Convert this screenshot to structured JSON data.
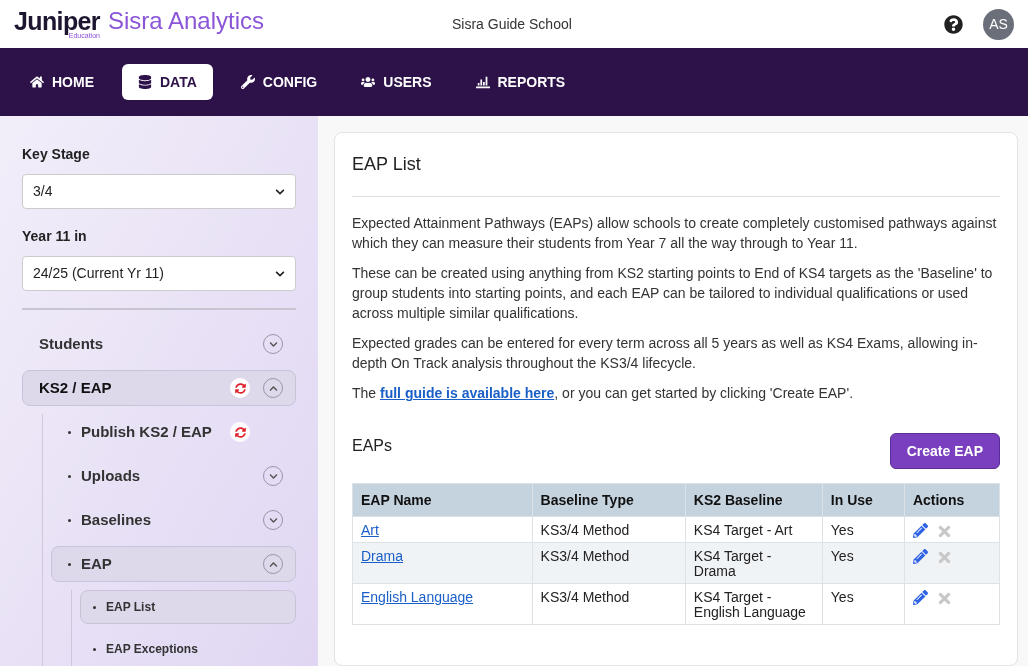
{
  "brand": {
    "name": "Juniper",
    "sub": "Education",
    "product": "Sisra Analytics"
  },
  "school": "Sisra Guide School",
  "user": {
    "initials": "AS"
  },
  "nav": [
    {
      "label": "HOME",
      "kind": "home",
      "selected": false
    },
    {
      "label": "DATA",
      "kind": "database",
      "selected": true
    },
    {
      "label": "CONFIG",
      "kind": "wrench",
      "selected": false
    },
    {
      "label": "USERS",
      "kind": "users",
      "selected": false
    },
    {
      "label": "REPORTS",
      "kind": "chart",
      "selected": false
    }
  ],
  "sidebar": {
    "filters": [
      {
        "label": "Key Stage",
        "value": "3/4"
      },
      {
        "label": "Year 11 in",
        "value": "24/25 (Current Yr 11)"
      }
    ],
    "items": [
      {
        "label": "Students",
        "selected": false,
        "sync": false,
        "expanded": false
      },
      {
        "label": "KS2 / EAP",
        "selected": true,
        "sync": true,
        "expanded": true,
        "children": [
          {
            "label": "Publish KS2 / EAP",
            "selected": false,
            "sync": true
          },
          {
            "label": "Uploads",
            "selected": false,
            "sync": false,
            "expanded": false
          },
          {
            "label": "Baselines",
            "selected": false,
            "sync": false,
            "expanded": false
          },
          {
            "label": "EAP",
            "selected": true,
            "sync": false,
            "expanded": true,
            "children": [
              {
                "label": "EAP List",
                "selected": true,
                "sync": false
              },
              {
                "label": "EAP Exceptions",
                "selected": false,
                "sync": false
              }
            ]
          }
        ]
      }
    ]
  },
  "main": {
    "title": "EAP List",
    "paragraphs": [
      {
        "text": "Expected Attainment Pathways (EAPs) allow schools to create completely customised pathways against which they can measure their students from Year 7 all the way through to Year 11."
      },
      {
        "text": "These can be created using anything from KS2 starting points to End of KS4 targets as the 'Baseline' to group students into starting points, and each EAP can be tailored to individual qualifications or used across multiple similar qualifications."
      },
      {
        "text": "Expected grades can be entered for every term across all 5 years as well as KS4 Exams, allowing in-depth On Track analysis throughout the KS3/4 lifecycle."
      },
      {
        "text": "The ",
        "link": "full guide is available here",
        "after": ", or you can get started by clicking 'Create EAP'."
      }
    ],
    "section": "EAPs",
    "create_button": "Create EAP",
    "table": {
      "columns": [
        "EAP Name",
        "Baseline Type",
        "KS2 Baseline",
        "In Use",
        "Actions"
      ],
      "rows": [
        {
          "name": "Art",
          "baseline_type": "KS3/4 Method",
          "ks2_baseline": "KS4 Target - Art",
          "in_use": "Yes",
          "delete_disabled": true
        },
        {
          "name": "Drama",
          "baseline_type": "KS3/4 Method",
          "ks2_baseline": "KS4 Target - Drama",
          "in_use": "Yes",
          "delete_disabled": true
        },
        {
          "name": "English Language",
          "baseline_type": "KS3/4 Method",
          "ks2_baseline": "KS4 Target - English Language",
          "in_use": "Yes",
          "delete_disabled": true
        }
      ]
    }
  }
}
